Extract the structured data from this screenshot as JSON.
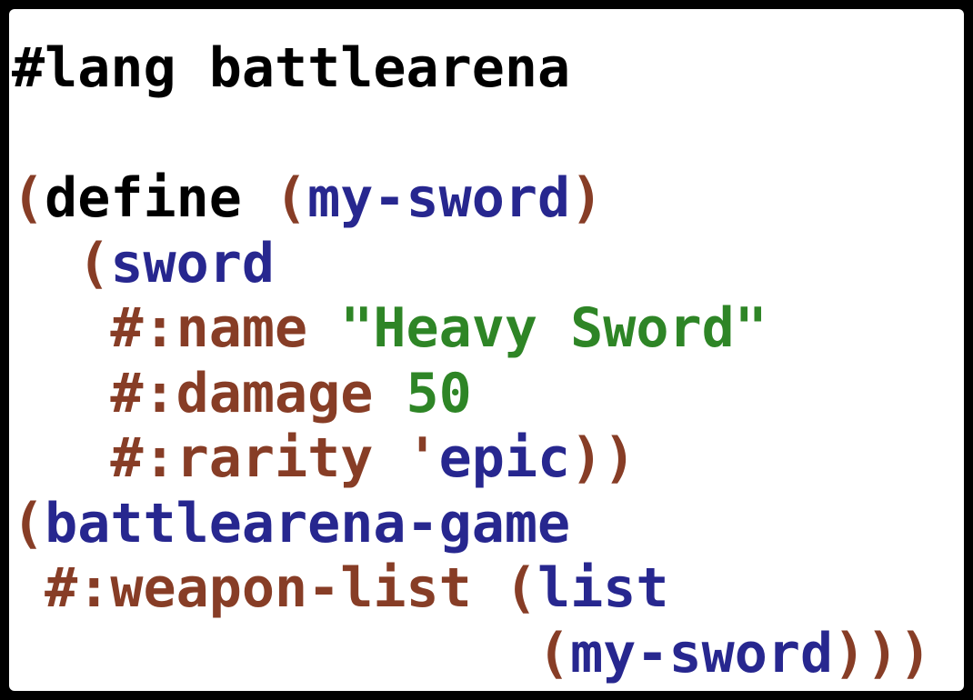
{
  "editor": {
    "colors": {
      "background": "#ffffff",
      "border": "#000000",
      "plain": "#000000",
      "paren": "#873d26",
      "symbol": "#27278f",
      "keyword": "#873d26",
      "literal": "#2e8526"
    },
    "lines": [
      [
        {
          "text": "#lang battlearena",
          "role": "plain"
        }
      ],
      [],
      [
        {
          "text": "(",
          "role": "paren"
        },
        {
          "text": "define",
          "role": "plain"
        },
        {
          "text": " ",
          "role": "plain"
        },
        {
          "text": "(",
          "role": "paren"
        },
        {
          "text": "my-sword",
          "role": "symbol"
        },
        {
          "text": ")",
          "role": "paren"
        }
      ],
      [
        {
          "text": "  ",
          "role": "plain"
        },
        {
          "text": "(",
          "role": "paren"
        },
        {
          "text": "sword",
          "role": "symbol"
        }
      ],
      [
        {
          "text": "   ",
          "role": "plain"
        },
        {
          "text": "#:name",
          "role": "keyword"
        },
        {
          "text": " ",
          "role": "plain"
        },
        {
          "text": "\"Heavy Sword\"",
          "role": "literal"
        }
      ],
      [
        {
          "text": "   ",
          "role": "plain"
        },
        {
          "text": "#:damage",
          "role": "keyword"
        },
        {
          "text": " ",
          "role": "plain"
        },
        {
          "text": "50",
          "role": "literal"
        }
      ],
      [
        {
          "text": "   ",
          "role": "plain"
        },
        {
          "text": "#:rarity",
          "role": "keyword"
        },
        {
          "text": " ",
          "role": "plain"
        },
        {
          "text": "'",
          "role": "paren"
        },
        {
          "text": "epic",
          "role": "symbol"
        },
        {
          "text": "))",
          "role": "paren"
        }
      ],
      [
        {
          "text": "(",
          "role": "paren"
        },
        {
          "text": "battlearena-game",
          "role": "symbol"
        }
      ],
      [
        {
          "text": " ",
          "role": "plain"
        },
        {
          "text": "#:weapon-list",
          "role": "keyword"
        },
        {
          "text": " ",
          "role": "plain"
        },
        {
          "text": "(",
          "role": "paren"
        },
        {
          "text": "list",
          "role": "symbol"
        }
      ],
      [
        {
          "text": "                ",
          "role": "plain"
        },
        {
          "text": "(",
          "role": "paren"
        },
        {
          "text": "my-sword",
          "role": "symbol"
        },
        {
          "text": ")))",
          "role": "paren"
        }
      ]
    ]
  }
}
